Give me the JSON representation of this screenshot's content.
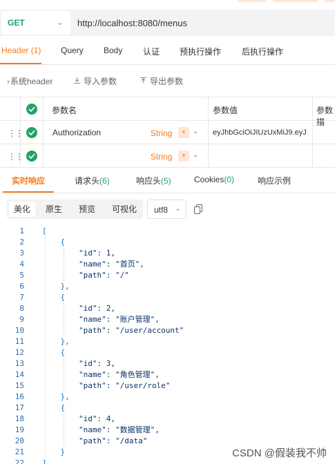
{
  "request": {
    "method": "GET",
    "url": "http://localhost:8080/menus"
  },
  "request_tabs": [
    {
      "label": "Header (1)"
    },
    {
      "label": "Query"
    },
    {
      "label": "Body"
    },
    {
      "label": "认证"
    },
    {
      "label": "预执行操作"
    },
    {
      "label": "后执行操作"
    }
  ],
  "toolbar": {
    "system_header": "系统header",
    "import_params": "导入参数",
    "export_params": "导出参数"
  },
  "params_table": {
    "headers": {
      "name": "参数名",
      "value": "参数值",
      "desc": "参数描"
    },
    "rows": [
      {
        "name": "Authorization",
        "type": "String",
        "required": "*",
        "value": "eyJhbGciOiJIUzUxMiJ9.eyJ"
      },
      {
        "name": "",
        "type": "String",
        "required": "*",
        "value": ""
      }
    ]
  },
  "response_tabs": {
    "realtime": "实时响应",
    "req_headers": "请求头",
    "req_headers_count": "(6)",
    "resp_headers": "响应头",
    "resp_headers_count": "(5)",
    "cookies": "Cookies",
    "cookies_count": "(0)",
    "example": "响应示例"
  },
  "view_modes": {
    "beautify": "美化",
    "raw": "原生",
    "preview": "预览",
    "visualize": "可视化",
    "encoding": "utf8"
  },
  "code_lines": [
    "[",
    "    {",
    "        \"id\": 1,",
    "        \"name\": \"首页\",",
    "        \"path\": \"/\"",
    "    },",
    "    {",
    "        \"id\": 2,",
    "        \"name\": \"账户管理\",",
    "        \"path\": \"/user/account\"",
    "    },",
    "    {",
    "        \"id\": 3,",
    "        \"name\": \"角色管理\",",
    "        \"path\": \"/user/role\"",
    "    },",
    "    {",
    "        \"id\": 4,",
    "        \"name\": \"数据管理\",",
    "        \"path\": \"/data\"",
    "    }",
    "]"
  ],
  "watermark": "CSDN @假装我不帅",
  "colors": {
    "accent": "#f47b20",
    "success": "#21a366"
  }
}
